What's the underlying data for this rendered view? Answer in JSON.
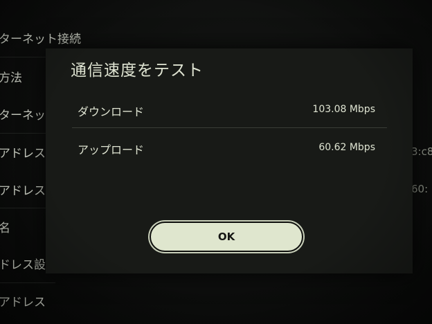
{
  "background_list": {
    "items": [
      {
        "label": "ターネット接続"
      },
      {
        "label": "方法"
      },
      {
        "label": "ターネット"
      },
      {
        "label": "アドレス"
      },
      {
        "label": "アドレス"
      },
      {
        "label": "名"
      },
      {
        "label": "ドレス設定"
      },
      {
        "label": "アドレス"
      }
    ],
    "right_values": [
      {
        "value": "3:c8"
      },
      {
        "value": "60:"
      }
    ]
  },
  "dialog": {
    "title": "通信速度をテスト",
    "rows": [
      {
        "label": "ダウンロード",
        "value": "103.08 Mbps"
      },
      {
        "label": "アップロード",
        "value": "60.62 Mbps"
      }
    ],
    "ok_label": "OK"
  },
  "colors": {
    "dialog_bg": "#181a17",
    "text": "#dfe4d2",
    "button_bg": "#dfe6ce"
  }
}
